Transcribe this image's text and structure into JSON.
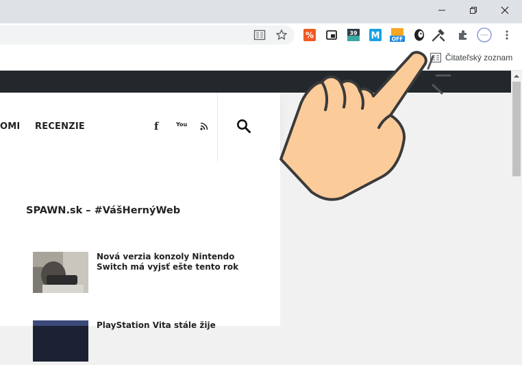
{
  "toolbar": {
    "extensions": [
      {
        "name": "percent-extension-icon",
        "color": "#f05a22",
        "glyph": "%"
      },
      {
        "name": "picture-in-picture-icon",
        "color": "#222222",
        "glyph": "▣"
      },
      {
        "name": "counter-extension-icon",
        "color": "#2f3e46",
        "glyph": "39"
      },
      {
        "name": "m-extension-icon",
        "color": "#1ba1e2",
        "glyph": "M"
      },
      {
        "name": "off-extension-icon",
        "color": "#f5a623",
        "glyph": "OFF"
      },
      {
        "name": "mask-extension-icon",
        "color": "#222222",
        "glyph": "◐"
      },
      {
        "name": "tools-extension-icon",
        "color": "#444444",
        "glyph": "⚒"
      },
      {
        "name": "puzzle-icon",
        "color": "#5f6368",
        "glyph": "✱"
      }
    ]
  },
  "bookmarks": {
    "reading_list_label": "Čitateľský zoznam"
  },
  "site": {
    "nav": {
      "item_partial": "OMI",
      "item_reviews": "RECENZIE"
    },
    "social": {
      "facebook": "f",
      "youtube": "You",
      "rss": "⟆"
    },
    "section_title": "SPAWN.sk – #VášHernýWeb",
    "articles": [
      {
        "title": "Nová verzia konzoly Nintendo Switch má vyjsť ešte tento rok"
      },
      {
        "title": "PlayStation Vita stále žije"
      }
    ]
  }
}
